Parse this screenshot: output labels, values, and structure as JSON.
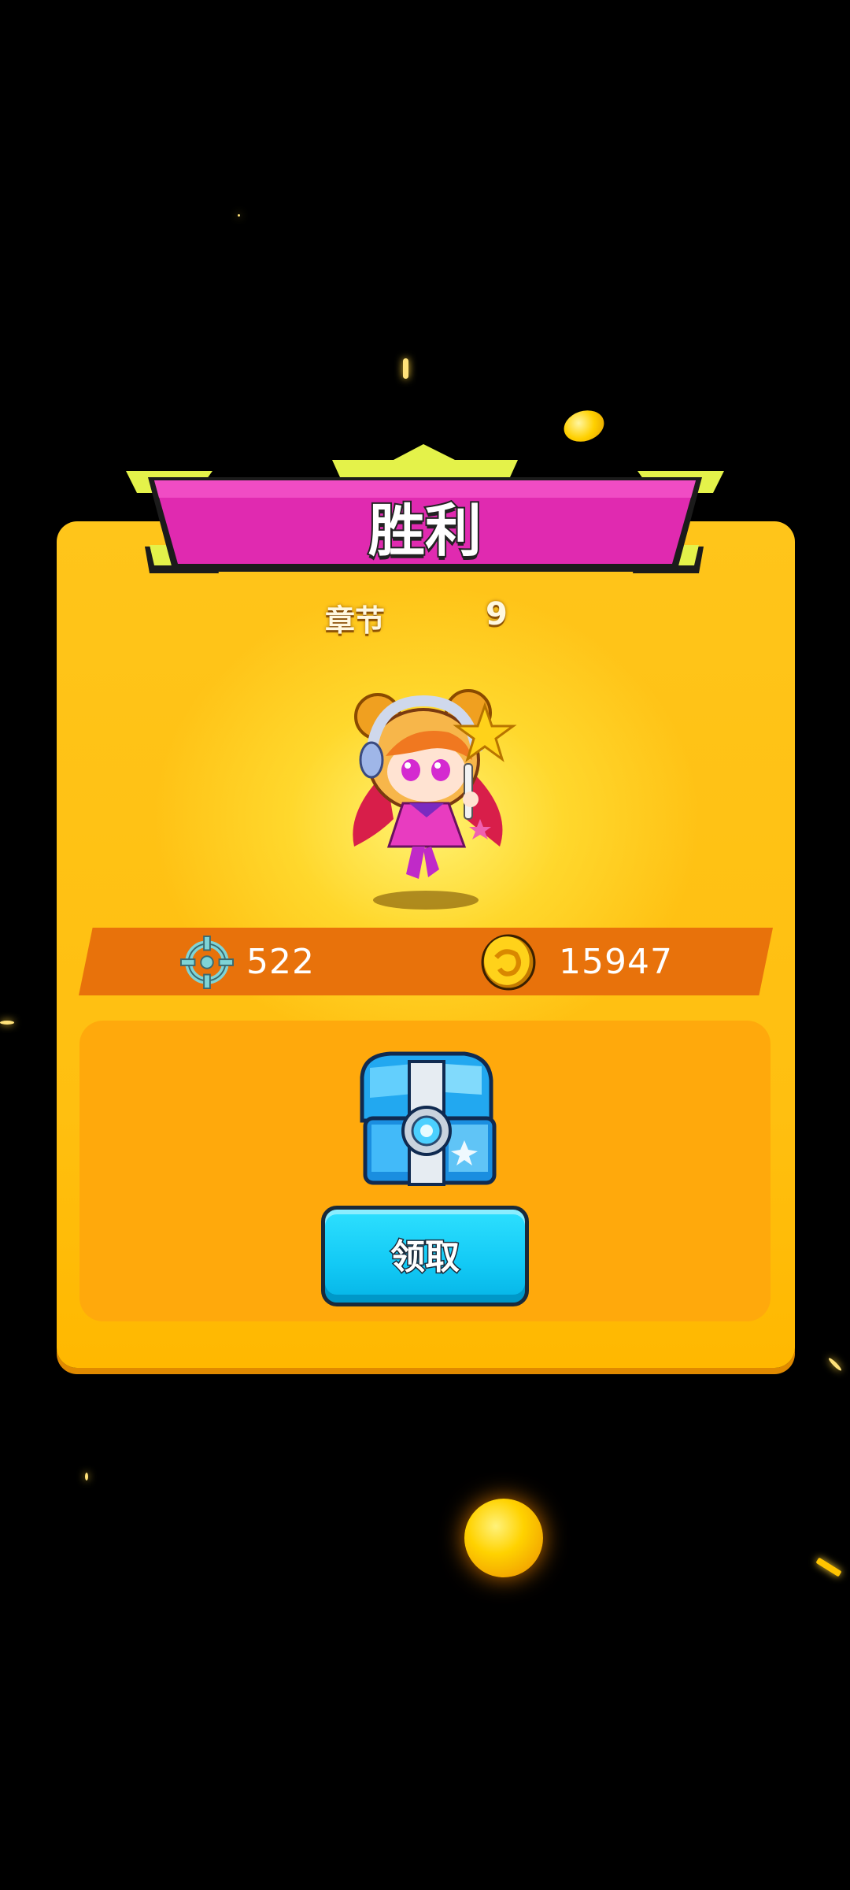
{
  "result": {
    "title": "胜利",
    "chapter_label": "章节",
    "chapter_value": "9"
  },
  "stats": {
    "kills": {
      "icon": "crosshair-icon",
      "value": "522"
    },
    "coins": {
      "icon": "gold-coin-icon",
      "value": "15947"
    }
  },
  "reward": {
    "item_icon": "treasure-chest-icon",
    "claim_label": "领取"
  },
  "colors": {
    "panel": "#ffc51a",
    "ribbon": "#e02ab0",
    "ribbon_accent": "#e4f24a",
    "stats_bar": "#e8720b",
    "reward_box": "#ffa90c",
    "claim_button": "#12c9f5"
  }
}
